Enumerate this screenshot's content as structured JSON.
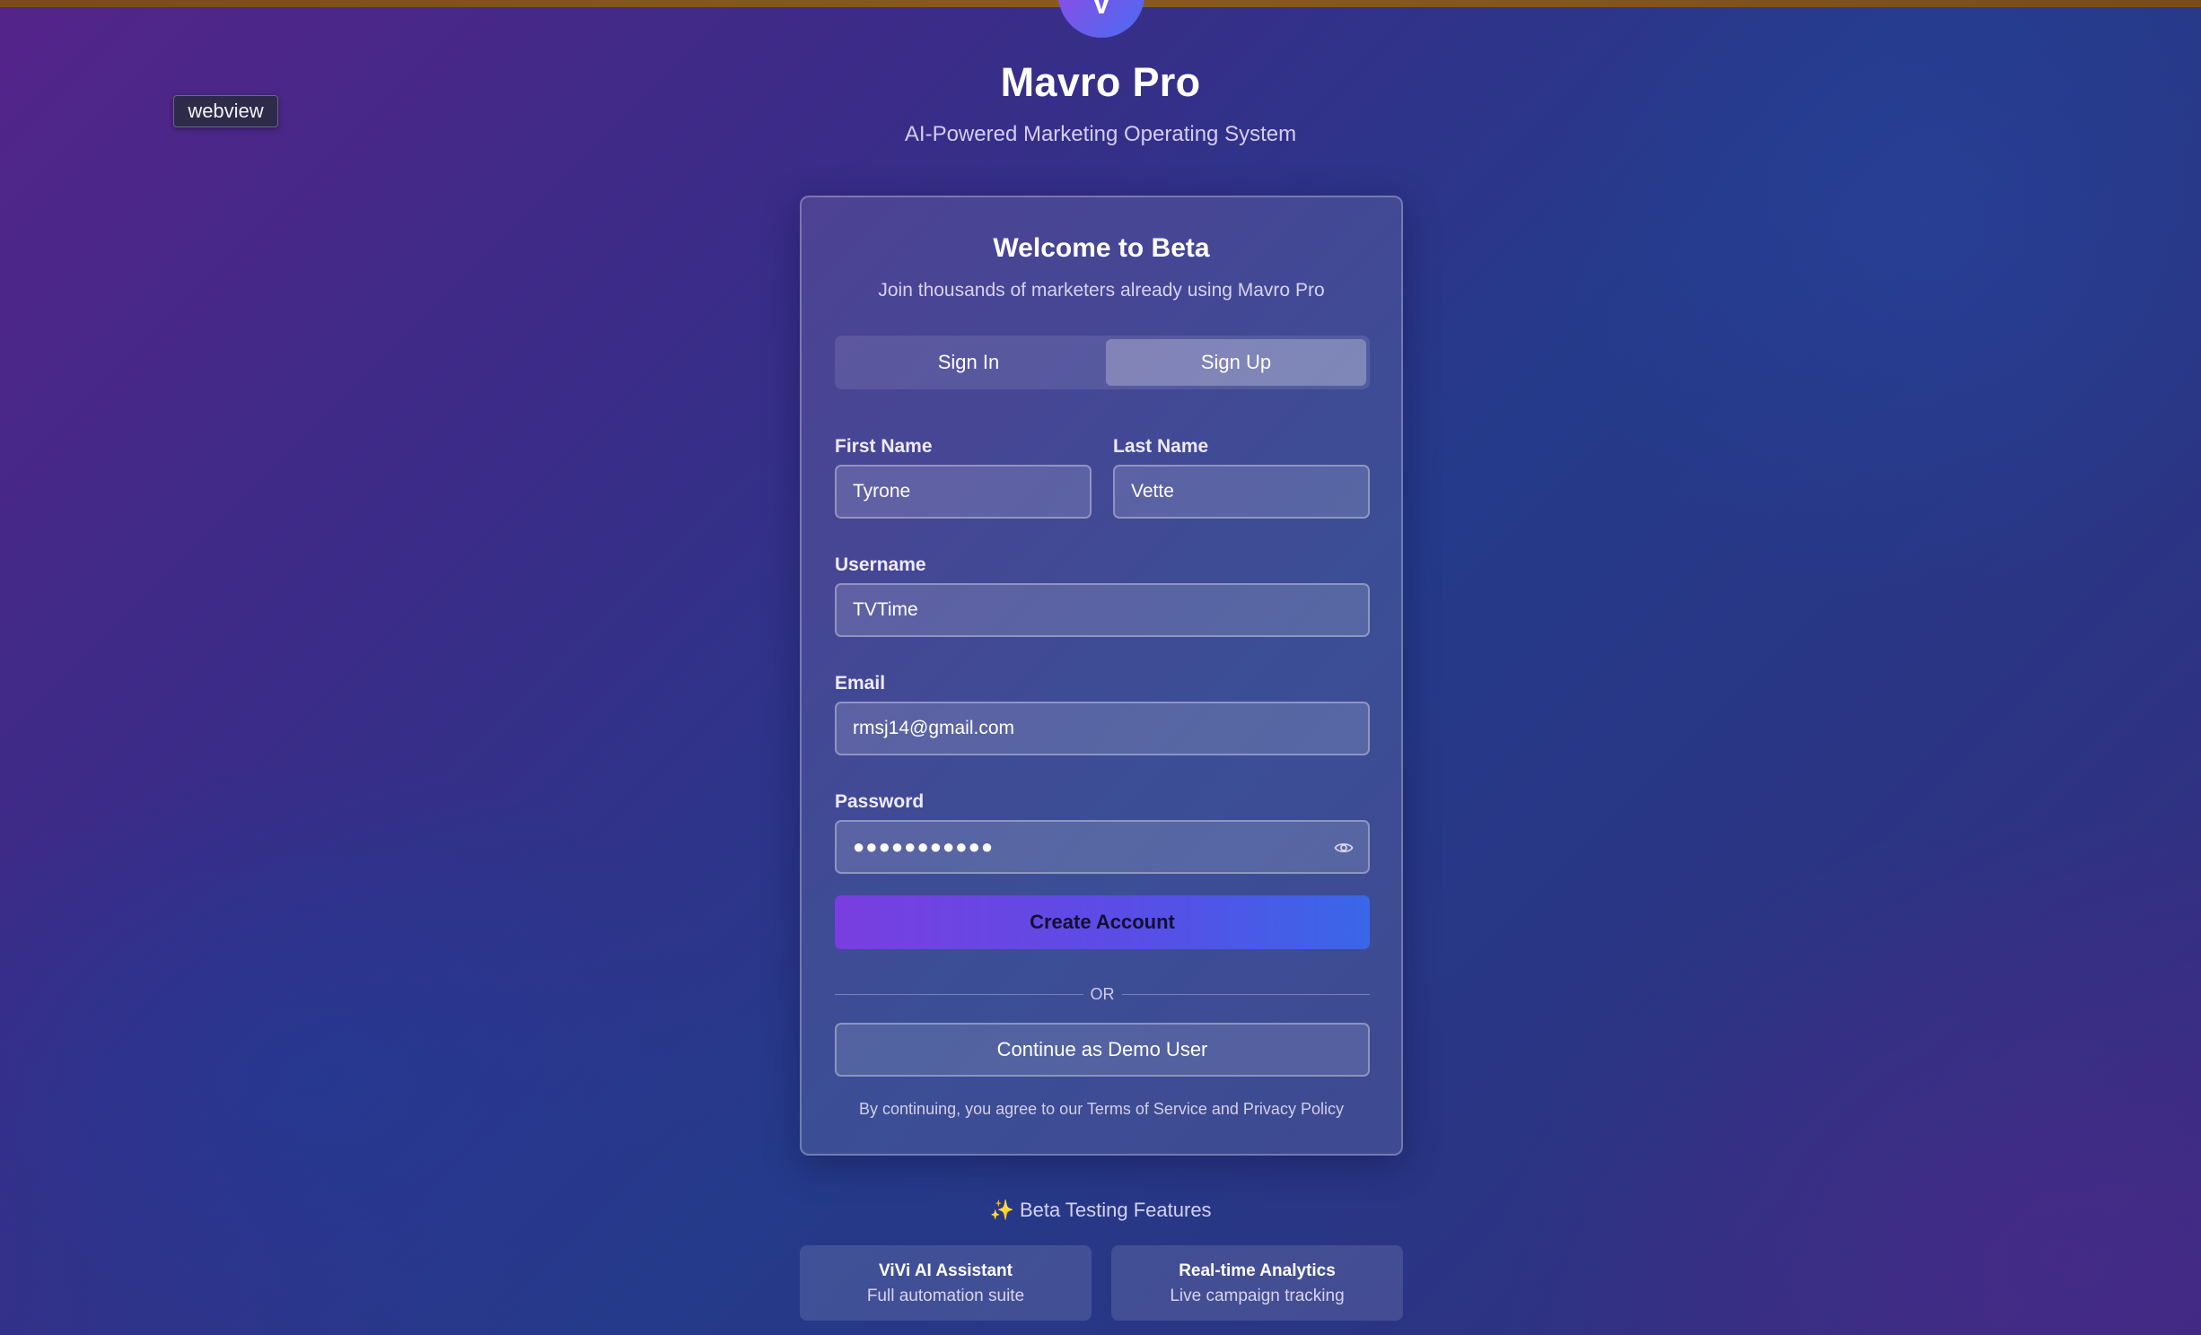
{
  "app": {
    "logo_letter": "V",
    "title": "Mavro Pro",
    "subtitle": "AI-Powered Marketing Operating System"
  },
  "tooltip": "webview",
  "card": {
    "title": "Welcome to Beta",
    "subtitle": "Join thousands of marketers already using Mavro Pro",
    "tabs": [
      {
        "label": "Sign In",
        "active": false
      },
      {
        "label": "Sign Up",
        "active": true
      }
    ],
    "fields": {
      "first_name": {
        "label": "First Name",
        "value": "Tyrone"
      },
      "last_name": {
        "label": "Last Name",
        "value": "Vette"
      },
      "username": {
        "label": "Username",
        "value": "TVTime"
      },
      "email": {
        "label": "Email",
        "value": "rmsj14@gmail.com"
      },
      "password": {
        "label": "Password",
        "value": "●●●●●●●●●●●"
      }
    },
    "create_button": "Create Account",
    "divider_text": "OR",
    "demo_button": "Continue as Demo User",
    "terms": "By continuing, you agree to our Terms of Service and Privacy Policy"
  },
  "beta": {
    "heading": "✨ Beta Testing Features",
    "features": [
      {
        "title": "ViVi AI Assistant",
        "desc": "Full automation suite"
      },
      {
        "title": "Real-time Analytics",
        "desc": "Live campaign tracking"
      }
    ]
  },
  "icons": {
    "password_toggle": "eye-icon"
  },
  "colors": {
    "accent_start": "#7a3ee0",
    "accent_end": "#3a66e8",
    "top_bar": "#7a4a1e"
  }
}
